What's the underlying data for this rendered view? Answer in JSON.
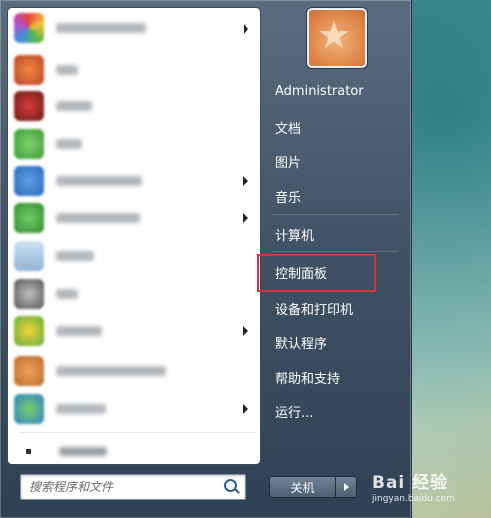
{
  "user": {
    "name": "Administrator"
  },
  "right_menu": {
    "items": [
      {
        "label": "文档"
      },
      {
        "label": "图片"
      },
      {
        "label": "音乐"
      },
      {
        "label": "计算机"
      },
      {
        "label": "控制面板"
      },
      {
        "label": "设备和打印机"
      },
      {
        "label": "默认程序"
      },
      {
        "label": "帮助和支持"
      },
      {
        "label": "运行..."
      }
    ]
  },
  "search": {
    "placeholder": "搜索程序和文件"
  },
  "power": {
    "shutdown_label": "关机"
  },
  "watermark": {
    "brand": "Bai 经验",
    "url": "jingyan.baidu.com"
  },
  "colors": {
    "highlight": "#d9323a",
    "menu_bg": "#3f5163"
  },
  "icons": [
    "star-avatar-icon",
    "search-icon",
    "arrow-right-icon"
  ]
}
